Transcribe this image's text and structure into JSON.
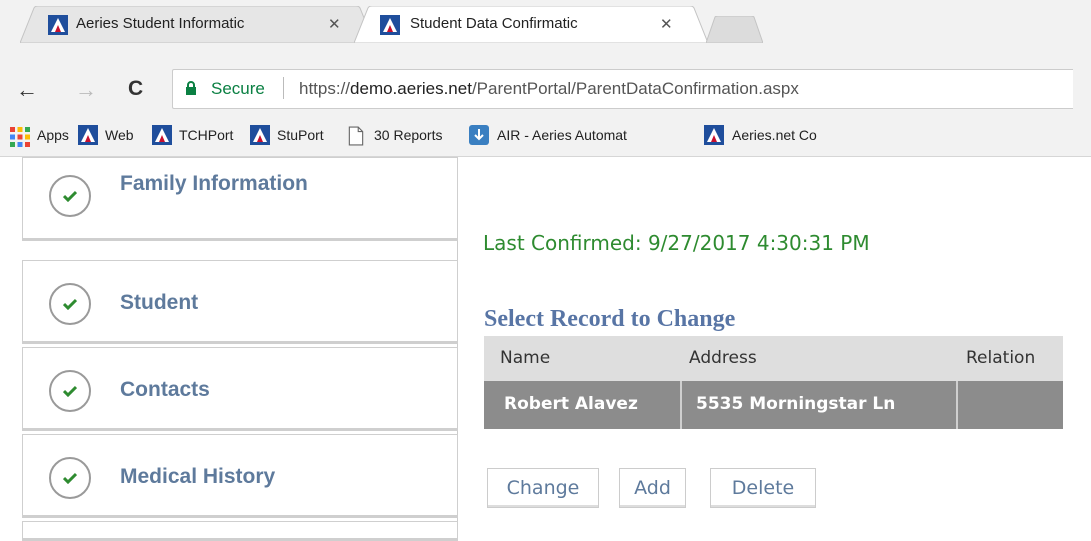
{
  "browser": {
    "tabs": [
      {
        "title": "Aeries Student Informatic",
        "active": false
      },
      {
        "title": "Student Data Confirmatic",
        "active": true
      }
    ],
    "address": {
      "secure_label": "Secure",
      "url_scheme": "https://",
      "url_host": "demo.aeries.net",
      "url_path": "/ParentPortal/ParentDataConfirmation.aspx"
    },
    "bookmarks": [
      {
        "label": "Apps",
        "icon": "apps-grid-icon"
      },
      {
        "label": "Web",
        "icon": "aeries-logo-icon"
      },
      {
        "label": "TCHPort",
        "icon": "aeries-logo-icon"
      },
      {
        "label": "StuPort",
        "icon": "aeries-logo-icon"
      },
      {
        "label": "30 Reports",
        "icon": "page-icon"
      },
      {
        "label": "AIR - Aeries Automat",
        "icon": "air-icon"
      },
      {
        "label": "Aeries.net Co",
        "icon": "aeries-logo-icon"
      }
    ]
  },
  "sidebar": {
    "items": [
      {
        "label": "Family Information",
        "status": "complete"
      },
      {
        "label": "Student",
        "status": "complete"
      },
      {
        "label": "Contacts",
        "status": "complete"
      },
      {
        "label": "Medical History",
        "status": "complete"
      }
    ]
  },
  "main": {
    "last_confirmed": "Last Confirmed: 9/27/2017 4:30:31 PM",
    "select_title": "Select Record to Change",
    "table": {
      "columns": [
        "Name",
        "Address",
        "Relation"
      ],
      "rows": [
        {
          "name": "Robert Alavez",
          "address": "5535 Morningstar Ln",
          "relation": ""
        }
      ]
    },
    "buttons": {
      "change": "Change",
      "add": "Add",
      "delete": "Delete"
    }
  },
  "colors": {
    "accent_blue": "#5e7a9c",
    "confirm_green": "#2e8b30",
    "aeries_red": "#c8102e",
    "aeries_blue": "#1f4e9c"
  }
}
